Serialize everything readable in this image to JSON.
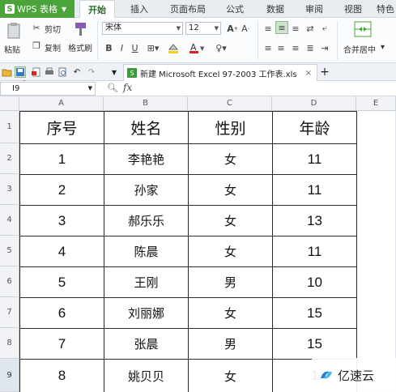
{
  "app": {
    "title": "WPS 表格"
  },
  "menu_tabs": [
    "开始",
    "插入",
    "页面布局",
    "公式",
    "数据",
    "审阅",
    "视图",
    "特色"
  ],
  "ribbon": {
    "paste_label": "粘贴",
    "cut_label": "剪切",
    "copy_label": "复制",
    "format_painter_label": "格式刷",
    "font_name": "宋体",
    "font_size": "12",
    "bold": "B",
    "italic": "I",
    "underline": "U",
    "merge_center_label": "合并居中"
  },
  "doc_tab": {
    "title": "新建 Microsoft Excel 97-2003 工作表.xls"
  },
  "formula_bar": {
    "name_box": "I9",
    "fx_label": "fx"
  },
  "columns": [
    "A",
    "B",
    "C",
    "D",
    "E"
  ],
  "rows": [
    "1",
    "2",
    "3",
    "4",
    "5",
    "6",
    "7",
    "8",
    "9"
  ],
  "table": {
    "headers": [
      "序号",
      "姓名",
      "性别",
      "年龄"
    ],
    "data": [
      [
        "1",
        "李艳艳",
        "女",
        "11"
      ],
      [
        "2",
        "孙家",
        "女",
        "11"
      ],
      [
        "3",
        "郝乐乐",
        "女",
        "13"
      ],
      [
        "4",
        "陈晨",
        "女",
        "11"
      ],
      [
        "5",
        "王刚",
        "男",
        "10"
      ],
      [
        "6",
        "刘丽娜",
        "女",
        "15"
      ],
      [
        "7",
        "张晨",
        "男",
        "15"
      ],
      [
        "8",
        "姚贝贝",
        "女",
        "1"
      ]
    ]
  },
  "watermark": {
    "text": "亿速云"
  },
  "colors": {
    "accent": "#4aa43a",
    "annotation_arrow": "#d9261c"
  }
}
